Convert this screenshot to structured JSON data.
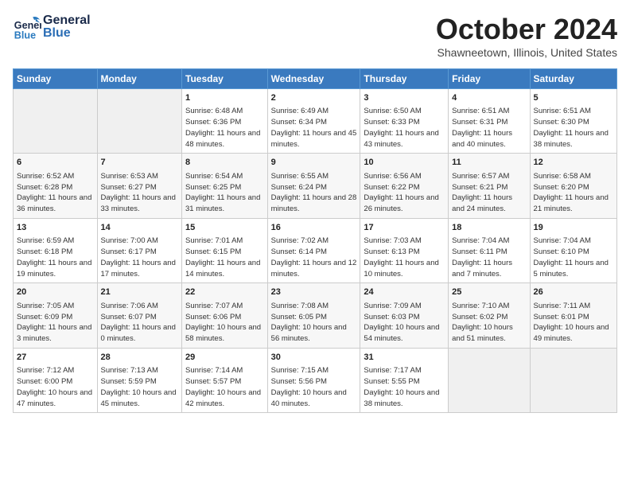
{
  "header": {
    "logo_general": "General",
    "logo_blue": "Blue",
    "month": "October 2024",
    "location": "Shawneetown, Illinois, United States"
  },
  "days_of_week": [
    "Sunday",
    "Monday",
    "Tuesday",
    "Wednesday",
    "Thursday",
    "Friday",
    "Saturday"
  ],
  "weeks": [
    [
      {
        "day": "",
        "detail": ""
      },
      {
        "day": "",
        "detail": ""
      },
      {
        "day": "1",
        "detail": "Sunrise: 6:48 AM\nSunset: 6:36 PM\nDaylight: 11 hours and 48 minutes."
      },
      {
        "day": "2",
        "detail": "Sunrise: 6:49 AM\nSunset: 6:34 PM\nDaylight: 11 hours and 45 minutes."
      },
      {
        "day": "3",
        "detail": "Sunrise: 6:50 AM\nSunset: 6:33 PM\nDaylight: 11 hours and 43 minutes."
      },
      {
        "day": "4",
        "detail": "Sunrise: 6:51 AM\nSunset: 6:31 PM\nDaylight: 11 hours and 40 minutes."
      },
      {
        "day": "5",
        "detail": "Sunrise: 6:51 AM\nSunset: 6:30 PM\nDaylight: 11 hours and 38 minutes."
      }
    ],
    [
      {
        "day": "6",
        "detail": "Sunrise: 6:52 AM\nSunset: 6:28 PM\nDaylight: 11 hours and 36 minutes."
      },
      {
        "day": "7",
        "detail": "Sunrise: 6:53 AM\nSunset: 6:27 PM\nDaylight: 11 hours and 33 minutes."
      },
      {
        "day": "8",
        "detail": "Sunrise: 6:54 AM\nSunset: 6:25 PM\nDaylight: 11 hours and 31 minutes."
      },
      {
        "day": "9",
        "detail": "Sunrise: 6:55 AM\nSunset: 6:24 PM\nDaylight: 11 hours and 28 minutes."
      },
      {
        "day": "10",
        "detail": "Sunrise: 6:56 AM\nSunset: 6:22 PM\nDaylight: 11 hours and 26 minutes."
      },
      {
        "day": "11",
        "detail": "Sunrise: 6:57 AM\nSunset: 6:21 PM\nDaylight: 11 hours and 24 minutes."
      },
      {
        "day": "12",
        "detail": "Sunrise: 6:58 AM\nSunset: 6:20 PM\nDaylight: 11 hours and 21 minutes."
      }
    ],
    [
      {
        "day": "13",
        "detail": "Sunrise: 6:59 AM\nSunset: 6:18 PM\nDaylight: 11 hours and 19 minutes."
      },
      {
        "day": "14",
        "detail": "Sunrise: 7:00 AM\nSunset: 6:17 PM\nDaylight: 11 hours and 17 minutes."
      },
      {
        "day": "15",
        "detail": "Sunrise: 7:01 AM\nSunset: 6:15 PM\nDaylight: 11 hours and 14 minutes."
      },
      {
        "day": "16",
        "detail": "Sunrise: 7:02 AM\nSunset: 6:14 PM\nDaylight: 11 hours and 12 minutes."
      },
      {
        "day": "17",
        "detail": "Sunrise: 7:03 AM\nSunset: 6:13 PM\nDaylight: 11 hours and 10 minutes."
      },
      {
        "day": "18",
        "detail": "Sunrise: 7:04 AM\nSunset: 6:11 PM\nDaylight: 11 hours and 7 minutes."
      },
      {
        "day": "19",
        "detail": "Sunrise: 7:04 AM\nSunset: 6:10 PM\nDaylight: 11 hours and 5 minutes."
      }
    ],
    [
      {
        "day": "20",
        "detail": "Sunrise: 7:05 AM\nSunset: 6:09 PM\nDaylight: 11 hours and 3 minutes."
      },
      {
        "day": "21",
        "detail": "Sunrise: 7:06 AM\nSunset: 6:07 PM\nDaylight: 11 hours and 0 minutes."
      },
      {
        "day": "22",
        "detail": "Sunrise: 7:07 AM\nSunset: 6:06 PM\nDaylight: 10 hours and 58 minutes."
      },
      {
        "day": "23",
        "detail": "Sunrise: 7:08 AM\nSunset: 6:05 PM\nDaylight: 10 hours and 56 minutes."
      },
      {
        "day": "24",
        "detail": "Sunrise: 7:09 AM\nSunset: 6:03 PM\nDaylight: 10 hours and 54 minutes."
      },
      {
        "day": "25",
        "detail": "Sunrise: 7:10 AM\nSunset: 6:02 PM\nDaylight: 10 hours and 51 minutes."
      },
      {
        "day": "26",
        "detail": "Sunrise: 7:11 AM\nSunset: 6:01 PM\nDaylight: 10 hours and 49 minutes."
      }
    ],
    [
      {
        "day": "27",
        "detail": "Sunrise: 7:12 AM\nSunset: 6:00 PM\nDaylight: 10 hours and 47 minutes."
      },
      {
        "day": "28",
        "detail": "Sunrise: 7:13 AM\nSunset: 5:59 PM\nDaylight: 10 hours and 45 minutes."
      },
      {
        "day": "29",
        "detail": "Sunrise: 7:14 AM\nSunset: 5:57 PM\nDaylight: 10 hours and 42 minutes."
      },
      {
        "day": "30",
        "detail": "Sunrise: 7:15 AM\nSunset: 5:56 PM\nDaylight: 10 hours and 40 minutes."
      },
      {
        "day": "31",
        "detail": "Sunrise: 7:17 AM\nSunset: 5:55 PM\nDaylight: 10 hours and 38 minutes."
      },
      {
        "day": "",
        "detail": ""
      },
      {
        "day": "",
        "detail": ""
      }
    ]
  ]
}
